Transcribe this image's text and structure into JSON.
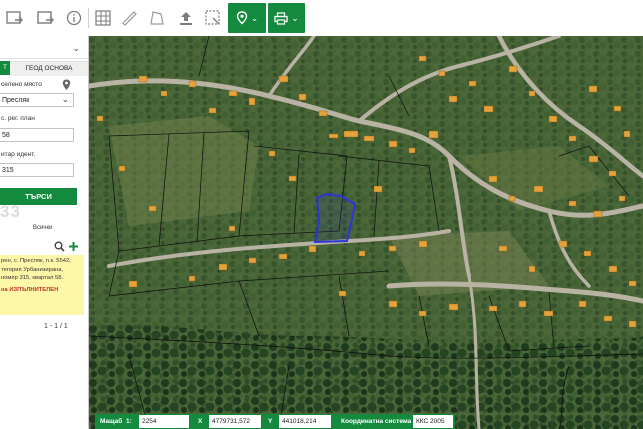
{
  "toolbar": {
    "icons": [
      "layers-in-icon",
      "layers-out-icon",
      "info-icon",
      "grid-icon",
      "ruler-icon",
      "area-icon",
      "upload-icon",
      "select-icon",
      "location-icon",
      "print-icon"
    ]
  },
  "panel": {
    "tabs": {
      "active": "Т",
      "other": "ГЕОД ОСНОВА"
    },
    "settlement_label": "селено място",
    "settlement_value": "Пресляк",
    "plan_label": "с. рег. план",
    "plan_value": "58",
    "identifier_label": "итар идент.",
    "identifier_value": "315",
    "search_button": "ТЪРСИ",
    "captcha_text": "33",
    "all_label": "Всички",
    "result_lines": [
      "рен, с. Пресляк, п.к. 5542,",
      "тегория Урбанизирана,",
      "номер 315, квартал 58.",
      "на ИЗПЪЛНИТЕЛЕН"
    ],
    "pager": "1 - 1 / 1"
  },
  "statusbar": {
    "scale_label": "Мащаб",
    "scale_prefix": "1:",
    "scale_value": "2254",
    "x_label": "X",
    "x_value": "4779731,572",
    "y_label": "Y",
    "y_value": "441018,214",
    "crs_label": "Координатна система",
    "crs_value": "ККС 2005"
  },
  "colors": {
    "accent": "#148a3e",
    "highlight": "#fff7a8",
    "parcel": "#2b35d8"
  }
}
